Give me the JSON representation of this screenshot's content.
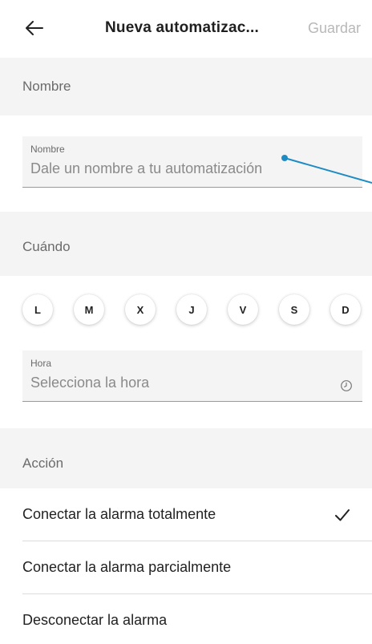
{
  "header": {
    "back_icon": "arrow-left-icon",
    "title": "Nueva automatizac...",
    "save_label": "Guardar"
  },
  "sections": {
    "name_label": "Nombre",
    "when_label": "Cuándo",
    "action_label": "Acción"
  },
  "name_field": {
    "label": "Nombre",
    "placeholder": "Dale un nombre a tu automatización",
    "value": ""
  },
  "days": [
    "L",
    "M",
    "X",
    "J",
    "V",
    "S",
    "D"
  ],
  "time_field": {
    "label": "Hora",
    "placeholder": "Selecciona la hora",
    "icon": "clock-icon"
  },
  "actions": [
    {
      "label": "Conectar la alarma totalmente",
      "selected": true
    },
    {
      "label": "Conectar la alarma parcialmente",
      "selected": false
    },
    {
      "label": "Desconectar la alarma",
      "selected": false
    }
  ],
  "colors": {
    "section_bg": "#f4f4f4",
    "save_disabled": "#b8b8b8",
    "pointer": "#1e8bc3"
  }
}
